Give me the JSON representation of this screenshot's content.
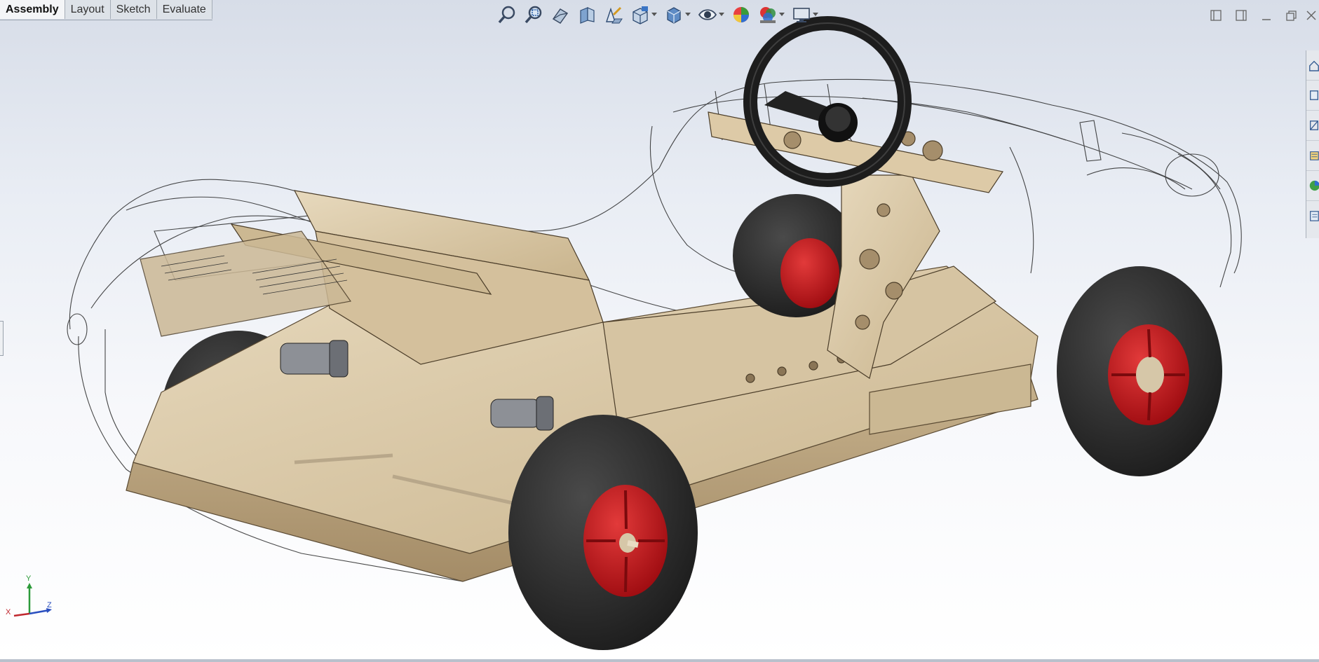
{
  "tabs": [
    {
      "label": "Assembly",
      "active": true
    },
    {
      "label": "Layout",
      "active": false
    },
    {
      "label": "Sketch",
      "active": false
    },
    {
      "label": "Evaluate",
      "active": false
    }
  ],
  "toolbar_icons": [
    "zoom-to-fit-icon",
    "zoom-to-area-icon",
    "previous-view-icon",
    "section-view-icon",
    "dynamic-annotation-icon",
    "view-orientation-icon",
    "display-style-icon",
    "hide-show-items-icon",
    "edit-appearance-icon",
    "apply-scene-icon",
    "view-settings-icon"
  ],
  "window_controls": [
    "tile-left-icon",
    "tile-right-icon",
    "minimize-icon",
    "restore-icon",
    "close-icon"
  ],
  "task_pane_icons": [
    "home-icon",
    "resources-icon",
    "design-library-icon",
    "file-explorer-icon",
    "appearances-icon",
    "custom-properties-icon"
  ],
  "triad": {
    "x_label": "X",
    "y_label": "Y",
    "z_label": "Z"
  },
  "colors": {
    "plywood": "#d8c6a4",
    "plywood_dark": "#b9a27c",
    "tire": "#2c2c2c",
    "rim": "#c8141a",
    "steering_wheel": "#1e1e1e"
  }
}
